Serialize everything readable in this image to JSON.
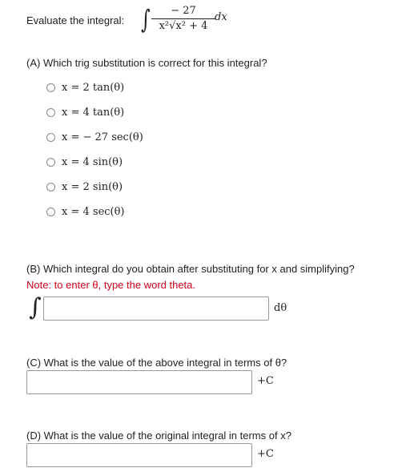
{
  "header": {
    "prompt": "Evaluate the integral:",
    "numerator": "− 27",
    "denominator": "x²√x² + 4",
    "differential": "dx"
  },
  "partA": {
    "question": "(A) Which trig substitution is correct for this integral?",
    "options": [
      "x = 2 tan(θ)",
      "x = 4 tan(θ)",
      "x = − 27 sec(θ)",
      "x = 4 sin(θ)",
      "x = 2 sin(θ)",
      "x = 4 sec(θ)"
    ]
  },
  "partB": {
    "question": "(B) Which integral do you obtain after substituting for x and simplifying?",
    "note": "Note: to enter θ, type the word theta.",
    "integral_sign": "∫",
    "differential": "dθ",
    "value": ""
  },
  "partC": {
    "question": "(C) What is the value of the above integral in terms of θ?",
    "suffix": "+C",
    "value": ""
  },
  "partD": {
    "question": "(D) What is the value of the original integral in terms of x?",
    "suffix": "+C",
    "value": ""
  }
}
